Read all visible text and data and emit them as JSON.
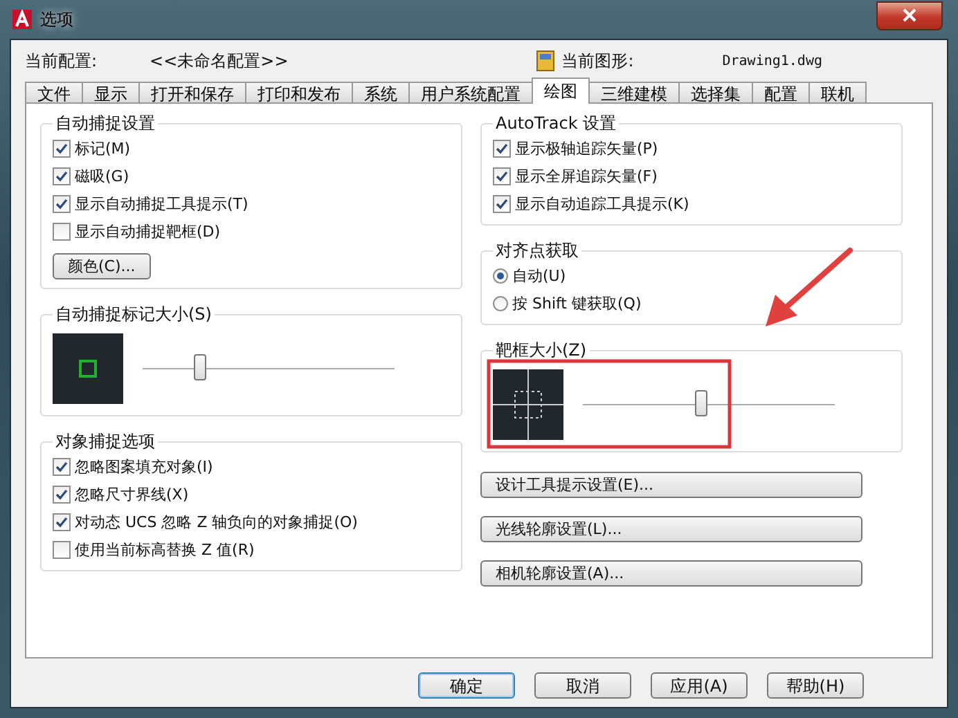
{
  "window": {
    "title": "选项"
  },
  "profile": {
    "label": "当前配置:",
    "value": "<<未命名配置>>"
  },
  "drawing": {
    "label": "当前图形:",
    "value": "Drawing1.dwg"
  },
  "tabs": [
    {
      "label": "文件",
      "selected": false
    },
    {
      "label": "显示",
      "selected": false
    },
    {
      "label": "打开和保存",
      "selected": false
    },
    {
      "label": "打印和发布",
      "selected": false
    },
    {
      "label": "系统",
      "selected": false
    },
    {
      "label": "用户系统配置",
      "selected": false
    },
    {
      "label": "绘图",
      "selected": true
    },
    {
      "label": "三维建模",
      "selected": false
    },
    {
      "label": "选择集",
      "selected": false
    },
    {
      "label": "配置",
      "selected": false
    },
    {
      "label": "联机",
      "selected": false
    }
  ],
  "autosnap": {
    "title": "自动捕捉设置",
    "options": [
      {
        "label": "标记(M)",
        "checked": true
      },
      {
        "label": "磁吸(G)",
        "checked": true
      },
      {
        "label": "显示自动捕捉工具提示(T)",
        "checked": true
      },
      {
        "label": "显示自动捕捉靶框(D)",
        "checked": false
      }
    ],
    "color_button": "颜色(C)..."
  },
  "marker_size": {
    "title": "自动捕捉标记大小(S)",
    "level": 0.23
  },
  "object_snap": {
    "title": "对象捕捉选项",
    "options": [
      {
        "label": "忽略图案填充对象(I)",
        "checked": true
      },
      {
        "label": "忽略尺寸界线(X)",
        "checked": true
      },
      {
        "label": "对动态 UCS 忽略 Z 轴负向的对象捕捉(O)",
        "checked": true
      },
      {
        "label": "使用当前标高替换 Z 值(R)",
        "checked": false
      }
    ]
  },
  "autotrack": {
    "title": "AutoTrack 设置",
    "options": [
      {
        "label": "显示极轴追踪矢量(P)",
        "checked": true
      },
      {
        "label": "显示全屏追踪矢量(F)",
        "checked": true
      },
      {
        "label": "显示自动追踪工具提示(K)",
        "checked": true
      }
    ]
  },
  "alignment": {
    "title": "对齐点获取",
    "options": [
      {
        "label": "自动(U)",
        "selected": true
      },
      {
        "label": "按 Shift 键获取(Q)",
        "selected": false
      }
    ]
  },
  "aperture": {
    "title": "靶框大小(Z)",
    "level": 0.47
  },
  "side_buttons": [
    "设计工具提示设置(E)...",
    "光线轮廓设置(L)...",
    "相机轮廓设置(A)..."
  ],
  "buttons": [
    {
      "label": "确定",
      "default": true
    },
    {
      "label": "取消",
      "default": false
    },
    {
      "label": "应用(A)",
      "default": false
    },
    {
      "label": "帮助(H)",
      "default": false
    }
  ]
}
